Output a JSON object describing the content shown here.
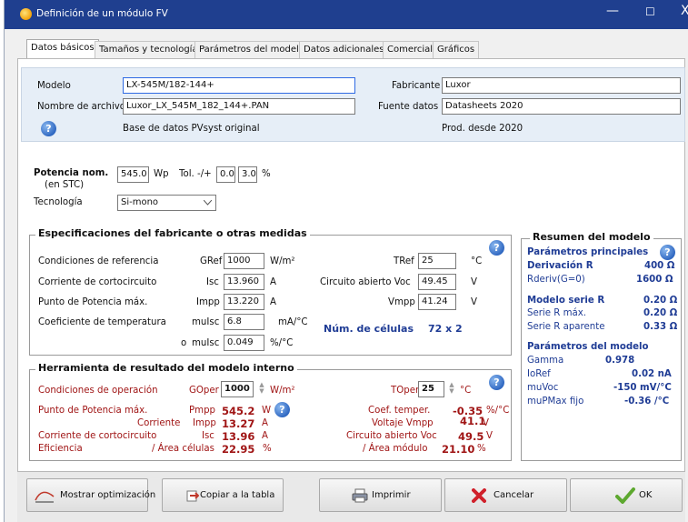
{
  "window": {
    "title": "Definición de un módulo FV",
    "min": "—",
    "max": "☐",
    "close": "X"
  },
  "tabs": [
    "Datos básicos",
    "Tamaños y tecnología",
    "Parámetros del modelo",
    "Datos adicionales",
    "Comercial",
    "Gráficos"
  ],
  "basic": {
    "modelo_label": "Modelo",
    "modelo_value": "LX-545M/182-144+",
    "fabricante_label": "Fabricante",
    "fabricante_value": "Luxor",
    "archivo_label": "Nombre de archivo",
    "archivo_value": "Luxor_LX_545M_182_144+.PAN",
    "fuente_label": "Fuente datos",
    "fuente_value": "Datasheets 2020",
    "base_text": "Base de datos PVsyst original",
    "prod_text": "Prod. desde 2020"
  },
  "power": {
    "label": "Potencia nom.",
    "sublabel": "(en STC)",
    "value": "545.0",
    "unit": "Wp",
    "tol_label": "Tol. -/+",
    "tol_minus": "0.0",
    "tol_plus": "3.0",
    "tol_unit": "%",
    "tech_label": "Tecnología",
    "tech_value": "Si-mono"
  },
  "specs": {
    "title": "Especificaciones del fabricante o otras medidas",
    "ref_label": "Condiciones de referencia",
    "gref_label": "GRef",
    "gref_value": "1000",
    "gref_unit": "W/m²",
    "tref_label": "TRef",
    "tref_value": "25",
    "tref_unit": "°C",
    "isc_row_label": "Corriente de cortocircuito",
    "isc_label": "Isc",
    "isc_value": "13.960",
    "isc_unit": "A",
    "voc_label": "Circuito abierto Voc",
    "voc_value": "49.45",
    "voc_unit": "V",
    "impp_row_label": "Punto de Potencia máx.",
    "impp_label": "Impp",
    "impp_value": "13.220",
    "impp_unit": "A",
    "vmpp_label": "Vmpp",
    "vmpp_value": "41.24",
    "vmpp_unit": "V",
    "coef_label": "Coeficiente de temperatura",
    "muisc_label": "muIsc",
    "muisc_value": "6.8",
    "muisc_unit": "mA/°C",
    "o_label": "o",
    "muisc2_label": "muIsc",
    "muisc2_value": "0.049",
    "muisc2_unit": "%/°C",
    "cells_label": "Núm. de células",
    "cells_value": "72 x 2"
  },
  "tool": {
    "title": "Herramienta de resultado del modelo interno",
    "cond_label": "Condiciones de operación",
    "goper_label": "GOper",
    "goper_value": "1000",
    "goper_unit": "W/m²",
    "toper_label": "TOper",
    "toper_value": "25",
    "toper_unit": "°C",
    "pmpp_row_label": "Punto de Potencia máx.",
    "pmpp_label": "Pmpp",
    "pmpp_value": "545.2",
    "pmpp_unit": "W",
    "coef_t_label": "Coef. temper.",
    "coef_t_value": "-0.35",
    "coef_t_unit": "%/°C",
    "corr_label": "Corriente",
    "impp_label": "Impp",
    "impp_value": "13.27",
    "impp_unit": "A",
    "vmpp_label": "Voltaje Vmpp",
    "vmpp_value": "41.1",
    "vmpp_unit": "V",
    "isc_row_label": "Corriente de cortocircuito",
    "isc_label": "Isc",
    "isc_value": "13.96",
    "isc_unit": "A",
    "voc_label": "Circuito abierto Voc",
    "voc_value": "49.5",
    "voc_unit": "V",
    "eff_label": "Eficiencia",
    "eff_cell_label": "/ Área células",
    "eff_cell_value": "22.95",
    "eff_cell_unit": "%",
    "eff_mod_label": "/ Área módulo",
    "eff_mod_value": "21.10",
    "eff_mod_unit": "%"
  },
  "summary": {
    "title": "Resumen del modelo",
    "main_title": "Parámetros principales",
    "rsh_label": "Derivación R",
    "rsh_value": "400 Ω",
    "rderiv_label": "Rderiv(G=0)",
    "rderiv_value": "1600 Ω",
    "rs_label": "Modelo serie R",
    "rs_value": "0.20 Ω",
    "rsmax_label": "Serie R máx.",
    "rsmax_value": "0.20 Ω",
    "rsapp_label": "Serie R aparente",
    "rsapp_value": "0.33 Ω",
    "model_title": "Parámetros del modelo",
    "gamma_label": "Gamma",
    "gamma_value": "0.978",
    "ioref_label": "IoRef",
    "ioref_value": "0.02 nA",
    "muvoc_label": "muVoc",
    "muvoc_value": "-150 mV/°C",
    "mupmax_label": "muPMax fijo",
    "mupmax_value": "-0.36 /°C"
  },
  "buttons": {
    "optim": "Mostrar optimización",
    "copy": "Copiar a la tabla",
    "print": "Imprimir",
    "cancel": "Cancelar",
    "ok": "OK"
  },
  "help_glyph": "?"
}
